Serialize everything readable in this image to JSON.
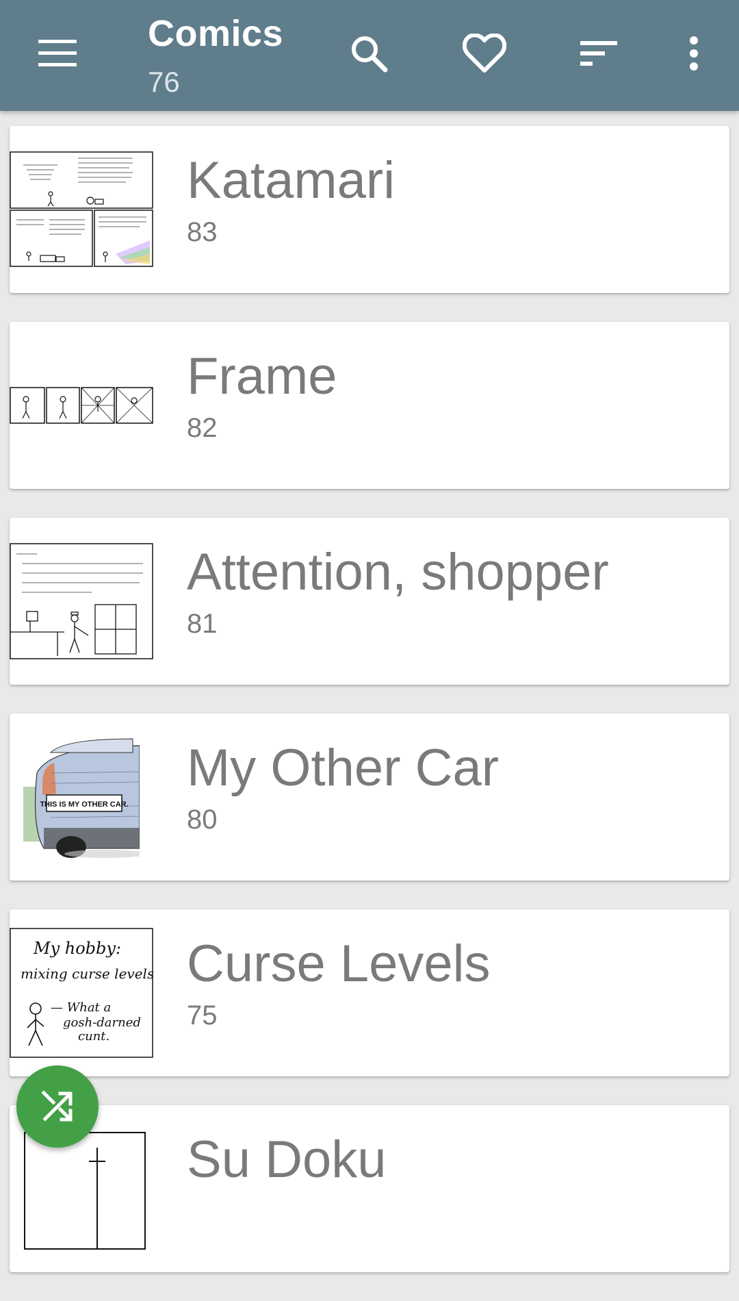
{
  "appbar": {
    "title": "Comics",
    "count": "76",
    "menu_icon": "menu-icon",
    "search_icon": "search-icon",
    "favorite_icon": "heart-icon",
    "sort_icon": "sort-icon",
    "more_icon": "more-vert-icon",
    "color": "#607d8b"
  },
  "comics": [
    {
      "title": "Katamari",
      "number": "83"
    },
    {
      "title": "Frame",
      "number": "82"
    },
    {
      "title": "Attention, shopper",
      "number": "81"
    },
    {
      "title": "My Other Car",
      "number": "80"
    },
    {
      "title": "Curse Levels",
      "number": "75"
    },
    {
      "title": "Su Doku",
      "number": ""
    }
  ],
  "thumbnail_texts": {
    "other_car_plate": "THIS IS MY OTHER CAR.",
    "curse_line1": "My hobby:",
    "curse_line2": "mixing curse levels",
    "curse_line3": "— What a",
    "curse_line4": "gosh-darned",
    "curse_line5": "cunt."
  },
  "fab": {
    "icon": "shuffle-icon",
    "color": "#43a047"
  }
}
